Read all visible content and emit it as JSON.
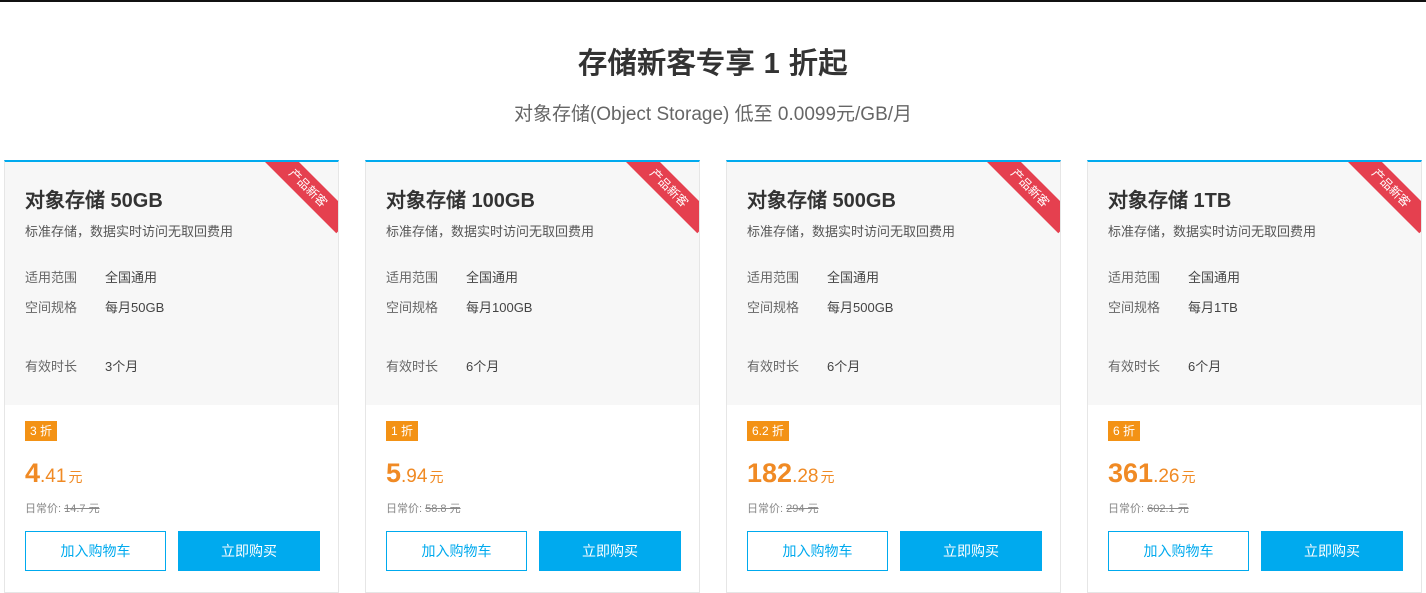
{
  "page": {
    "title": "存储新客专享 1 折起",
    "subtitle": "对象存储(Object Storage) 低至 0.0099元/GB/月",
    "accent_color": "#00aaee",
    "price_color": "#f08a24",
    "ribbon_color": "#e5404f"
  },
  "cards": [
    {
      "ribbon": "产品新客",
      "title": "对象存储 50GB",
      "desc": "标准存储，数据实时访问无取回费用",
      "scope_label": "适用范围",
      "scope": "全国通用",
      "spec_label": "空间规格",
      "spec": "每月50GB",
      "duration_label": "有效时长",
      "duration": "3个月",
      "discount": "3 折",
      "price_int": "4",
      "price_dec": ".41",
      "price_unit": "元",
      "orig_label": "日常价:",
      "orig": "14.7 元",
      "cart_label": "加入购物车",
      "buy_label": "立即购买"
    },
    {
      "ribbon": "产品新客",
      "title": "对象存储 100GB",
      "desc": "标准存储，数据实时访问无取回费用",
      "scope_label": "适用范围",
      "scope": "全国通用",
      "spec_label": "空间规格",
      "spec": "每月100GB",
      "duration_label": "有效时长",
      "duration": "6个月",
      "discount": "1 折",
      "price_int": "5",
      "price_dec": ".94",
      "price_unit": "元",
      "orig_label": "日常价:",
      "orig": "58.8 元",
      "cart_label": "加入购物车",
      "buy_label": "立即购买"
    },
    {
      "ribbon": "产品新客",
      "title": "对象存储 500GB",
      "desc": "标准存储，数据实时访问无取回费用",
      "scope_label": "适用范围",
      "scope": "全国通用",
      "spec_label": "空间规格",
      "spec": "每月500GB",
      "duration_label": "有效时长",
      "duration": "6个月",
      "discount": "6.2 折",
      "price_int": "182",
      "price_dec": ".28",
      "price_unit": "元",
      "orig_label": "日常价:",
      "orig": "294 元",
      "cart_label": "加入购物车",
      "buy_label": "立即购买"
    },
    {
      "ribbon": "产品新客",
      "title": "对象存储 1TB",
      "desc": "标准存储，数据实时访问无取回费用",
      "scope_label": "适用范围",
      "scope": "全国通用",
      "spec_label": "空间规格",
      "spec": "每月1TB",
      "duration_label": "有效时长",
      "duration": "6个月",
      "discount": "6 折",
      "price_int": "361",
      "price_dec": ".26",
      "price_unit": "元",
      "orig_label": "日常价:",
      "orig": "602.1 元",
      "cart_label": "加入购物车",
      "buy_label": "立即购买"
    }
  ]
}
